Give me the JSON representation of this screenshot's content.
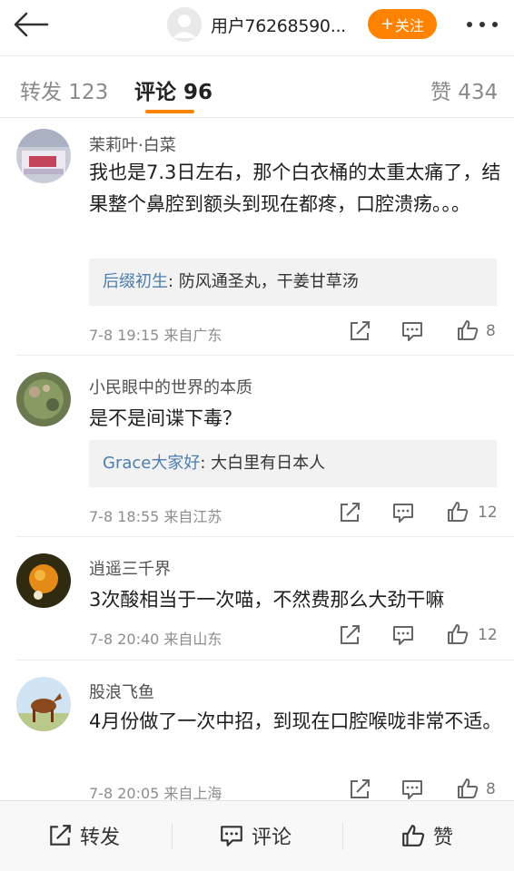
{
  "header": {
    "user_name": "用户76268590...",
    "follow_label": "关注",
    "follow_plus": "+"
  },
  "tabs": {
    "repost": "转发 123",
    "comments": "评论 96",
    "likes": "赞 434"
  },
  "comments": [
    {
      "nickname": "茉莉叶·白菜",
      "text": "我也是7.3日左右，那个白衣桶的太重太痛了，结果整个鼻腔到额头到现在都疼，口腔溃疡。。。",
      "reply_name": "后缀初生",
      "reply_text": ": 防风通圣丸，干姜甘草汤",
      "meta": "7-8 19:15  来自广东",
      "likes": "8"
    },
    {
      "nickname": "小民眼中的世界的本质",
      "text": "是不是间谍下毒？",
      "reply_name": "Grace大家好",
      "reply_text": ": 大白里有日本人",
      "meta": "7-8 18:55  来自江苏",
      "likes": "12"
    },
    {
      "nickname": "逍遥三千界",
      "text": "3次酸相当于一次喵，不然费那么大劲干嘛",
      "meta": "7-8 20:40  来自山东",
      "likes": "12"
    },
    {
      "nickname": "股浪飞鱼",
      "text": "4月份做了一次中招，到现在口腔喉咙非常不适。",
      "meta": "7-8 20:05  来自上海",
      "likes": "8"
    }
  ],
  "bottom_bar": {
    "repost": "转发",
    "comment": "评论",
    "like": "赞"
  },
  "colors": {
    "accent": "#ff8200",
    "reply_name": "#4f7dac",
    "meta": "#8d8d8d"
  },
  "icons": [
    "back-arrow-icon",
    "more-icon",
    "share-icon",
    "comment-icon",
    "like-icon"
  ]
}
